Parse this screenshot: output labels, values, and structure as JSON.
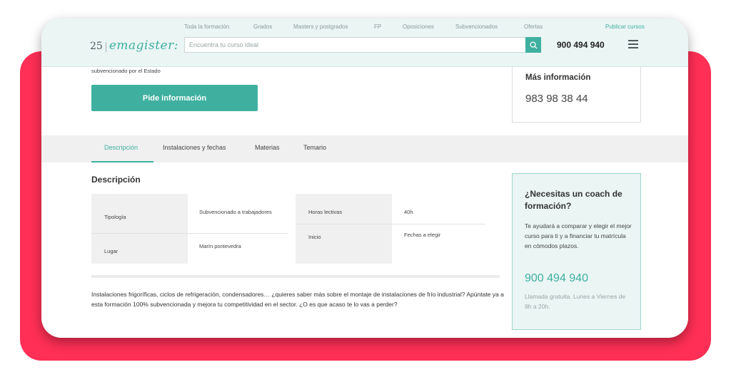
{
  "header": {
    "nav": [
      "Toda la formación",
      "Grados",
      "Masters y postgrados",
      "FP",
      "Oposiciones",
      "Subvencionados",
      "Ofertas"
    ],
    "publish_link": "Publicar cursos",
    "logo_number": "25",
    "logo_name": "emagister:",
    "search_placeholder": "Encuentra tu curso ideal",
    "search_value": "",
    "phone": "900 494 940"
  },
  "course": {
    "subsidy_text": "subvencionado por el Estado",
    "request_button": "Pide información"
  },
  "info_box": {
    "title": "Más información",
    "phone": "983 98 38 44"
  },
  "tabs": [
    "Descripción",
    "Instalaciones y fechas",
    "Materias",
    "Temario"
  ],
  "active_tab": "Descripción",
  "description": {
    "title": "Descripción",
    "details_left": [
      {
        "label": "Tipología",
        "value": "Subvencionado a trabajadores"
      },
      {
        "label": "Lugar",
        "value": "Marín pontevedra"
      }
    ],
    "details_right": [
      {
        "label": "Horas lectivas",
        "value": "40h"
      },
      {
        "label": "Inicio",
        "value": "Fechas a elegir"
      }
    ],
    "body": "Instalaciones frigoríficas, ciclos de refrigeración, condensadores… ¿quieres saber más sobre el montaje de instalaciones de frío industrial? Apúntate ya a esta formación 100% subvencionada y mejora tu competitividad en el sector. ¿O es que acaso te lo vas a perder?"
  },
  "coach": {
    "title": "¿Necesitas un coach de formación?",
    "text": "Te ayudará a comparar y elegir el mejor curso para ti y a financiar tu matrícula en cómodos plazos.",
    "phone": "900 494 940",
    "note": "Llamada gratuita. Lunes a Viernes de 9h a 20h."
  },
  "colors": {
    "accent": "#3fb0a0",
    "frame": "#ff2f55",
    "header_bg": "#eaf5f4"
  }
}
